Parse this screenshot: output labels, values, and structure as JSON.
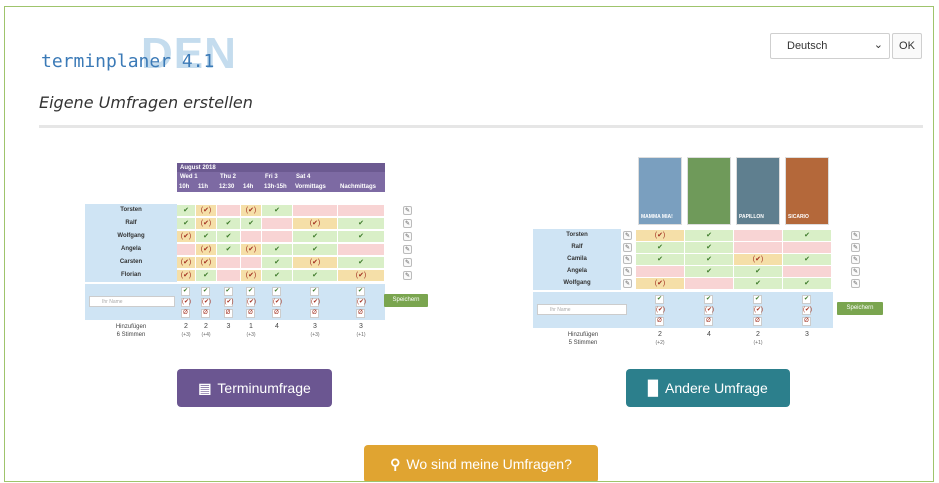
{
  "header": {
    "logo_text": "terminplaner 4.1",
    "logo_badge": "DEN",
    "language": "Deutsch",
    "ok_label": "OK",
    "page_title": "Eigene Umfragen erstellen"
  },
  "termin_poll": {
    "month": "August 2018",
    "days": [
      {
        "label": "Wed 1",
        "times": [
          "10h",
          "11h"
        ]
      },
      {
        "label": "Thu 2",
        "times": [
          "12:30",
          "14h"
        ]
      },
      {
        "label": "Fri 3",
        "times": [
          "13h-15h"
        ]
      },
      {
        "label": "Sat 4",
        "times": [
          "Vormittags",
          "Nachmittags"
        ]
      }
    ],
    "rows": [
      {
        "name": "Torsten",
        "cells": [
          "y",
          "m",
          "n",
          "m",
          "y",
          "n",
          "n"
        ]
      },
      {
        "name": "Ralf",
        "cells": [
          "y",
          "m",
          "y",
          "y",
          "n",
          "m",
          "y"
        ]
      },
      {
        "name": "Wolfgang",
        "cells": [
          "m",
          "y",
          "y",
          "n",
          "n",
          "y",
          "y"
        ]
      },
      {
        "name": "Angela",
        "cells": [
          "n",
          "m",
          "y",
          "m",
          "y",
          "y",
          "n"
        ]
      },
      {
        "name": "Carsten",
        "cells": [
          "m",
          "m",
          "n",
          "n",
          "y",
          "m",
          "y"
        ]
      },
      {
        "name": "Florian",
        "cells": [
          "m",
          "y",
          "n",
          "m",
          "y",
          "y",
          "m"
        ]
      }
    ],
    "name_placeholder": "Ihr Name",
    "save_label": "Speichern",
    "summary_label": "Hinzufügen",
    "summary_votes": "6 Stimmen",
    "totals": [
      "2",
      "2",
      "3",
      "1",
      "4",
      "3",
      "3"
    ],
    "subtotals": [
      "(+3)",
      "(+4)",
      "",
      "(+3)",
      "",
      "(+3)",
      "(+1)"
    ]
  },
  "other_poll": {
    "posters": [
      "MAMMA MIA!",
      "",
      "PAPILLON",
      "SICARIO"
    ],
    "rows": [
      {
        "name": "Torsten",
        "cells": [
          "m",
          "y",
          "n",
          "y"
        ]
      },
      {
        "name": "Ralf",
        "cells": [
          "y",
          "y",
          "n",
          "n"
        ]
      },
      {
        "name": "Camila",
        "cells": [
          "y",
          "y",
          "m",
          "y"
        ]
      },
      {
        "name": "Angela",
        "cells": [
          "n",
          "y",
          "y",
          "n"
        ]
      },
      {
        "name": "Wolfgang",
        "cells": [
          "m",
          "n",
          "y",
          "y"
        ]
      }
    ],
    "name_placeholder": "Ihr Name",
    "save_label": "Speichern",
    "summary_label": "Hinzufügen",
    "summary_votes": "5 Stimmen",
    "totals": [
      "2",
      "4",
      "2",
      "3"
    ],
    "subtotals": [
      "(+2)",
      "",
      "(+1)",
      ""
    ]
  },
  "buttons": {
    "termin": "Terminumfrage",
    "andere": "Andere Umfrage",
    "wo": "Wo sind meine Umfragen?"
  },
  "icons": {
    "termin": "calendar-icon",
    "andere": "bar-chart-icon",
    "wo": "search-icon"
  },
  "colors": {
    "termin": "#6b5691",
    "andere": "#2c7f8c",
    "wo": "#e0a431",
    "save": "#7aa54f"
  }
}
